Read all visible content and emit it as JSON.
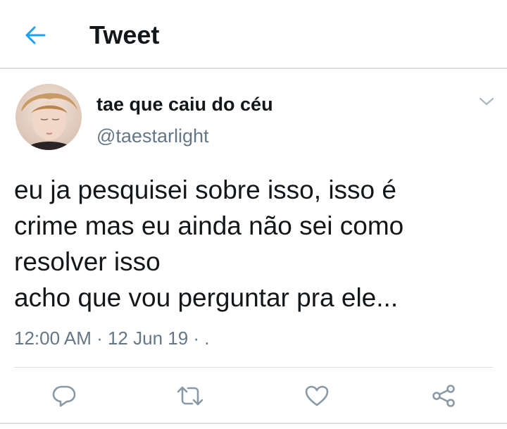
{
  "header": {
    "title": "Tweet",
    "back_icon": "arrow-left-icon",
    "accent_color": "#1da1f2"
  },
  "tweet": {
    "author_name": "tae que caiu do céu",
    "author_handle": "@taestarlight",
    "text_lines": [
      "eu ja pesquisei sobre isso, isso é",
      "crime mas eu ainda não sei como",
      "resolver isso",
      "acho que vou perguntar pra ele..."
    ],
    "time": "12:00 AM",
    "date": "12 Jun 19",
    "meta_separator": " · ",
    "meta_tail": "· ."
  },
  "actions": [
    {
      "name": "reply",
      "icon": "reply-icon"
    },
    {
      "name": "retweet",
      "icon": "retweet-icon"
    },
    {
      "name": "like",
      "icon": "heart-icon"
    },
    {
      "name": "share",
      "icon": "share-icon"
    }
  ],
  "colors": {
    "text": "#14171a",
    "secondary": "#657786",
    "divider": "#d9dde0",
    "icon": "#8a99a6"
  }
}
